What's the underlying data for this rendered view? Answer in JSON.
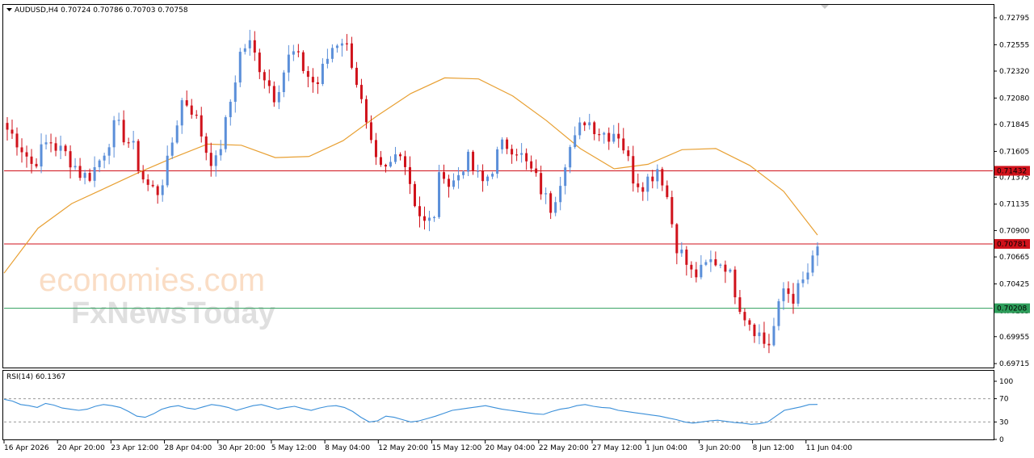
{
  "header": {
    "symbol_line": "AUDUSD,H4  0.70724 0.70786 0.70703 0.70758",
    "indicator_label": "RSI(14) 60.1367"
  },
  "watermark": {
    "line1": "economies.com",
    "line2": "FxNewsToday"
  },
  "colors": {
    "bull": "#5b8fd9",
    "bear": "#d0121b",
    "ma": "#e8a033",
    "resistance": "#d0121b",
    "support": "#2e9e5b",
    "rsi": "#3a8fd9",
    "grid": "#9a9a9a"
  },
  "chart_data": [
    {
      "type": "candlestick",
      "instrument": "AUDUSD",
      "timeframe": "H4",
      "price_ticks": [
        "0.72795",
        "0.72555",
        "0.72320",
        "0.72080",
        "0.71845",
        "0.71605",
        "0.71375",
        "0.71135",
        "0.70900",
        "0.70665",
        "0.70425",
        "0.70185",
        "0.69955",
        "0.69715"
      ],
      "time_ticks": [
        "16 Apr 2026",
        "20 Apr 20:00",
        "23 Apr 12:00",
        "28 Apr 04:00",
        "30 Apr 20:00",
        "5 May 12:00",
        "8 May 04:00",
        "12 May 20:00",
        "15 May 12:00",
        "20 May 04:00",
        "22 May 20:00",
        "27 May 12:00",
        "1 Jun 04:00",
        "3 Jun 20:00",
        "8 Jun 12:00",
        "11 Jun 04:00"
      ],
      "ylim": [
        0.6968,
        0.7291
      ],
      "levels": [
        {
          "label": "0.71432",
          "value": 0.71432,
          "role": "resistance"
        },
        {
          "label": "0.70781",
          "value": 0.70781,
          "role": "resistance"
        },
        {
          "label": "0.70208",
          "value": 0.70208,
          "role": "support"
        }
      ],
      "last_price": 0.70758,
      "moving_average_anchors": [
        0.7052,
        0.7092,
        0.7114,
        0.7128,
        0.7142,
        0.7155,
        0.7167,
        0.7166,
        0.7155,
        0.7156,
        0.717,
        0.7192,
        0.7212,
        0.7226,
        0.7225,
        0.721,
        0.7188,
        0.7163,
        0.7145,
        0.7149,
        0.7162,
        0.7163,
        0.7148,
        0.7125,
        0.7086
      ],
      "price_path": [
        0.718,
        0.7172,
        0.7161,
        0.7148,
        0.716,
        0.7171,
        0.7163,
        0.7158,
        0.7149,
        0.7138,
        0.714,
        0.7152,
        0.7168,
        0.7185,
        0.7174,
        0.7165,
        0.714,
        0.7128,
        0.7125,
        0.7143,
        0.7178,
        0.7208,
        0.72,
        0.7182,
        0.7157,
        0.715,
        0.718,
        0.7215,
        0.7252,
        0.7256,
        0.724,
        0.7225,
        0.721,
        0.723,
        0.725,
        0.724,
        0.7228,
        0.7218,
        0.7238,
        0.7255,
        0.7262,
        0.7248,
        0.7218,
        0.718,
        0.715,
        0.714,
        0.715,
        0.7165,
        0.714,
        0.711,
        0.7095,
        0.71,
        0.715,
        0.7128,
        0.714,
        0.7155,
        0.714,
        0.7132,
        0.7145,
        0.7164,
        0.7167,
        0.7163,
        0.715,
        0.714,
        0.7125,
        0.711,
        0.713,
        0.716,
        0.717,
        0.719,
        0.7185,
        0.7178,
        0.7176,
        0.718,
        0.716,
        0.7136,
        0.7132,
        0.7138,
        0.7148,
        0.712,
        0.708,
        0.7065,
        0.705,
        0.7052,
        0.7062,
        0.7063,
        0.706,
        0.704,
        0.7018,
        0.7008,
        0.6998,
        0.6985,
        0.701,
        0.704,
        0.703,
        0.704,
        0.7055,
        0.707
      ],
      "rsi": {
        "period": 14,
        "value": 60.1367,
        "levels": [
          70,
          30
        ],
        "scale_ticks": [
          "100",
          "70",
          "30",
          "0"
        ],
        "ylim": [
          0,
          100
        ],
        "anchors": [
          69,
          66,
          60,
          58,
          55,
          62,
          59,
          54,
          52,
          50,
          52,
          57,
          60,
          58,
          55,
          48,
          40,
          38,
          44,
          52,
          56,
          58,
          54,
          52,
          56,
          60,
          58,
          55,
          50,
          54,
          58,
          60,
          56,
          52,
          55,
          57,
          53,
          50,
          54,
          57,
          58,
          55,
          48,
          38,
          30,
          32,
          40,
          38,
          34,
          30,
          32,
          36,
          40,
          45,
          50,
          52,
          54,
          56,
          58,
          55,
          52,
          50,
          48,
          46,
          44,
          43,
          48,
          52,
          54,
          58,
          60,
          57,
          55,
          54,
          50,
          48,
          46,
          44,
          42,
          40,
          37,
          34,
          30,
          28,
          30,
          32,
          33,
          31,
          29,
          28,
          26,
          27,
          30,
          40,
          50,
          53,
          56,
          60
        ]
      }
    }
  ]
}
